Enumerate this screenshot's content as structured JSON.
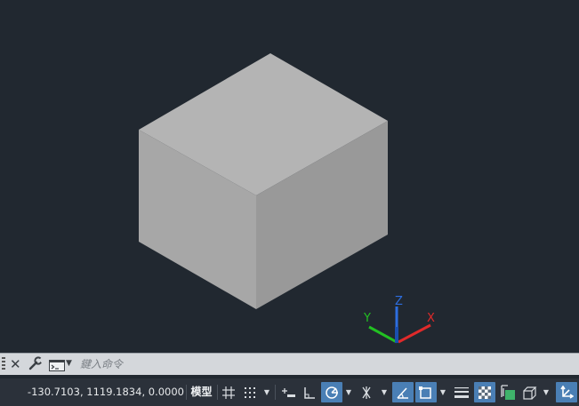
{
  "viewport": {
    "background": "#212830",
    "cube": {
      "top_color": "#b3b3b3",
      "left_color": "#a6a6a6",
      "right_color": "#999999"
    },
    "ucs": {
      "x_label": "X",
      "y_label": "Y",
      "z_label": "Z",
      "x_color": "#e02a2a",
      "y_color": "#22c022",
      "z_color": "#2d6ee0"
    }
  },
  "command_line": {
    "placeholder": "鍵入命令",
    "close_icon": "close-icon",
    "customize_icon": "wrench-icon",
    "recent_commands_icon": "command-prompt-icon"
  },
  "status_bar": {
    "coordinates": "-130.7103, 1119.1834, 0.0000",
    "model_label": "模型",
    "buttons": [
      {
        "name": "grid-display",
        "icon": "grid-icon",
        "active": false
      },
      {
        "name": "snap-mode",
        "icon": "snap-dots-icon",
        "active": false
      },
      {
        "name": "infer-constraints",
        "icon": "infer-constraints-icon",
        "active": false
      },
      {
        "name": "ortho-mode",
        "icon": "ortho-icon",
        "active": false
      },
      {
        "name": "polar-tracking",
        "icon": "polar-tracking-icon",
        "active": true
      },
      {
        "name": "isometric-drafting",
        "icon": "isodraft-icon",
        "active": false
      },
      {
        "name": "object-snap-tracking",
        "icon": "osnap-tracking-icon",
        "active": true
      },
      {
        "name": "object-snap",
        "icon": "osnap-icon",
        "active": true
      },
      {
        "name": "lineweight",
        "icon": "lineweight-icon",
        "active": false
      },
      {
        "name": "transparency",
        "icon": "transparency-icon",
        "active": true
      },
      {
        "name": "selection-cycling",
        "icon": "selection-cycling-icon",
        "active": false
      },
      {
        "name": "3d-object-snap",
        "icon": "3d-osnap-icon",
        "active": false
      },
      {
        "name": "dynamic-ucs",
        "icon": "dynamic-ucs-icon",
        "active": true
      }
    ],
    "active_color": "#4a7fb5"
  }
}
